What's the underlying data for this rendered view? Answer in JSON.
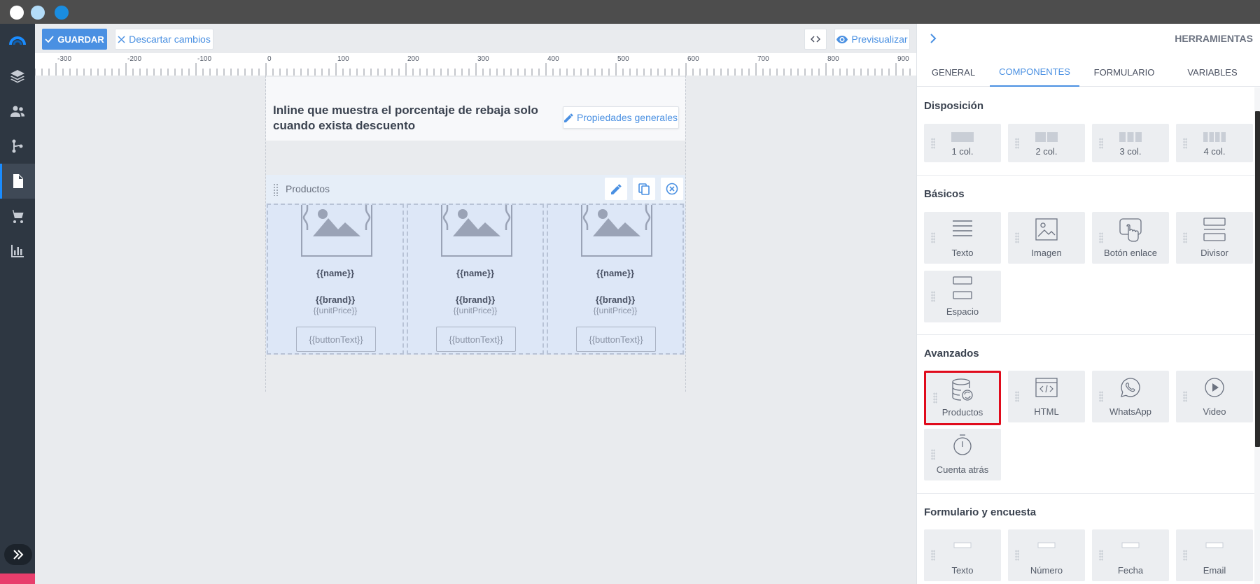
{
  "window": {
    "dots": [
      "#ffffff",
      "#b3dcf8",
      "#1a8de0"
    ]
  },
  "nav": {
    "items": [
      "logo-icon",
      "layers-icon",
      "contacts-icon",
      "flows-icon",
      "document-icon",
      "cart-icon",
      "chart-icon"
    ],
    "active": "document-icon",
    "accent": "#1a8cff",
    "spy_color": "#e83e6c"
  },
  "toolbar": {
    "save_label": "GUARDAR",
    "discard_label": "Descartar cambios",
    "preview_label": "Previsualizar"
  },
  "ruler": {
    "labels": [
      "-300",
      "-200",
      "-100",
      "0",
      "100",
      "200",
      "300",
      "400",
      "500",
      "600",
      "700",
      "800",
      "900"
    ]
  },
  "canvas": {
    "title": "Inline que muestra el porcentaje de rebaja solo cuando exista descuento",
    "props_button": "Propiedades generales",
    "products_bar_label": "Productos",
    "products": [
      {
        "name": "{{name}}",
        "brand": "{{brand}}",
        "price": "{{unitPrice}}",
        "button": "{{buttonText}}"
      },
      {
        "name": "{{name}}",
        "brand": "{{brand}}",
        "price": "{{unitPrice}}",
        "button": "{{buttonText}}"
      },
      {
        "name": "{{name}}",
        "brand": "{{brand}}",
        "price": "{{unitPrice}}",
        "button": "{{buttonText}}"
      }
    ]
  },
  "panel": {
    "title": "HERRAMIENTAS",
    "tabs": [
      {
        "label": "GENERAL",
        "active": false
      },
      {
        "label": "COMPONENTES",
        "active": true
      },
      {
        "label": "FORMULARIO",
        "active": false
      },
      {
        "label": "VARIABLES",
        "active": false
      }
    ],
    "sections": {
      "layout": {
        "title": "Disposición",
        "items": [
          "1 col.",
          "2 col.",
          "3 col.",
          "4 col."
        ]
      },
      "basic": {
        "title": "Básicos",
        "items": [
          "Texto",
          "Imagen",
          "Botón enlace",
          "Divisor",
          "Espacio"
        ]
      },
      "advanced": {
        "title": "Avanzados",
        "items": [
          "Productos",
          "HTML",
          "WhatsApp",
          "Video",
          "Cuenta atrás"
        ],
        "highlighted": "Productos"
      },
      "form": {
        "title": "Formulario y encuesta",
        "items": [
          "Texto",
          "Número",
          "Fecha",
          "Email"
        ]
      }
    }
  }
}
